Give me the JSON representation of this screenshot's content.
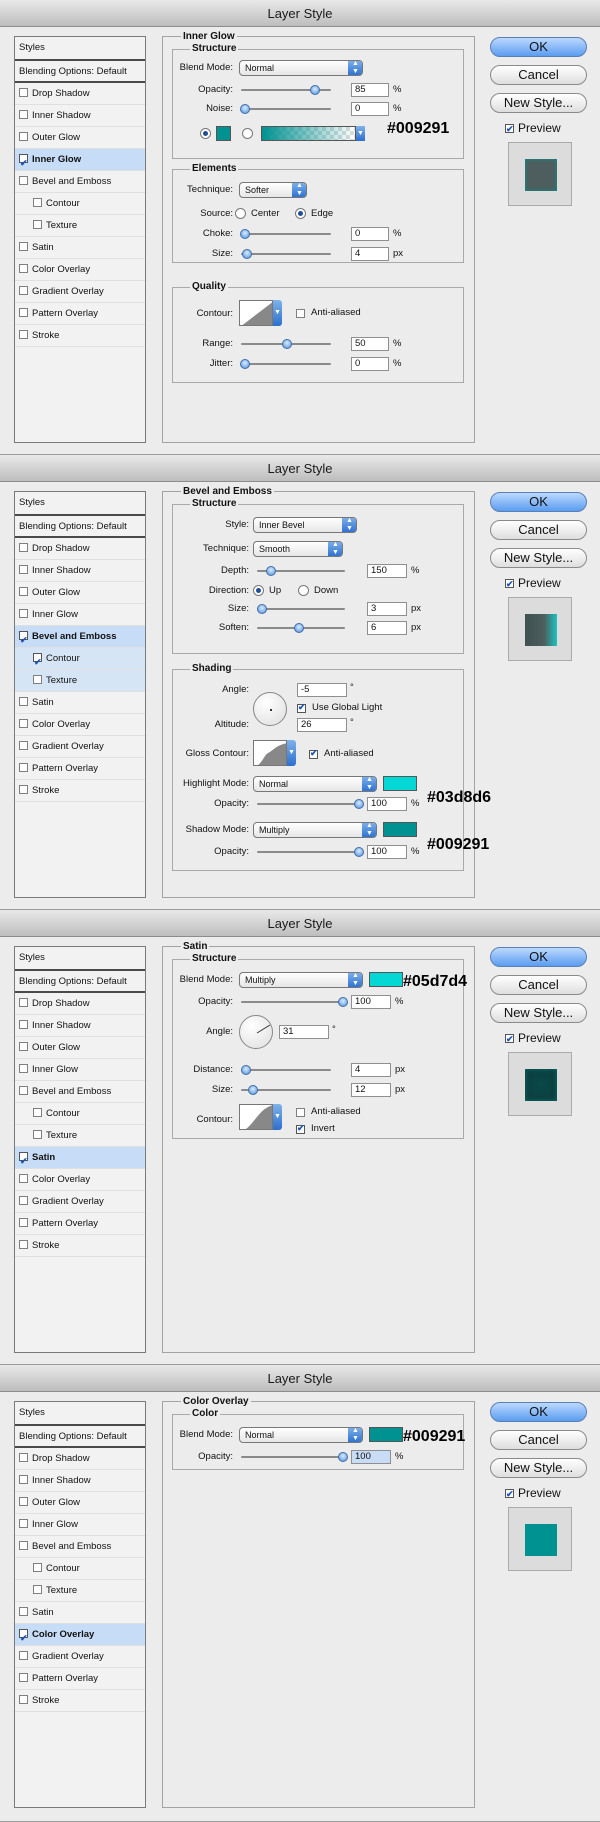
{
  "dialog_title": "Layer Style",
  "buttons": {
    "ok": "OK",
    "cancel": "Cancel",
    "new_style": "New Style...",
    "preview": "Preview"
  },
  "styles_list": [
    "Styles",
    "Blending Options: Default",
    "Drop Shadow",
    "Inner Shadow",
    "Outer Glow",
    "Inner Glow",
    "Bevel and Emboss",
    "Contour",
    "Texture",
    "Satin",
    "Color Overlay",
    "Gradient Overlay",
    "Pattern Overlay",
    "Stroke"
  ],
  "units": {
    "percent": "%",
    "px": "px",
    "deg": "°"
  },
  "panel1": {
    "section": "Inner Glow",
    "structure": "Structure",
    "blend_mode_label": "Blend Mode:",
    "blend_mode": "Normal",
    "opacity_label": "Opacity:",
    "opacity": "85",
    "noise_label": "Noise:",
    "noise": "0",
    "hex": "#009291",
    "elements": "Elements",
    "technique_label": "Technique:",
    "technique": "Softer",
    "source_label": "Source:",
    "source_center": "Center",
    "source_edge": "Edge",
    "choke_label": "Choke:",
    "choke": "0",
    "size_label": "Size:",
    "size": "4",
    "quality": "Quality",
    "contour_label": "Contour:",
    "anti_aliased": "Anti-aliased",
    "range_label": "Range:",
    "range": "50",
    "jitter_label": "Jitter:",
    "jitter": "0",
    "preview_color": "#4e5e5e"
  },
  "panel2": {
    "section": "Bevel and Emboss",
    "structure": "Structure",
    "style_label": "Style:",
    "style": "Inner Bevel",
    "technique_label": "Technique:",
    "technique": "Smooth",
    "depth_label": "Depth:",
    "depth": "150",
    "direction_label": "Direction:",
    "direction_up": "Up",
    "direction_down": "Down",
    "size_label": "Size:",
    "size": "3",
    "soften_label": "Soften:",
    "soften": "6",
    "shading": "Shading",
    "angle_label": "Angle:",
    "angle": "-5",
    "use_global_light": "Use Global Light",
    "altitude_label": "Altitude:",
    "altitude": "26",
    "gloss_contour_label": "Gloss Contour:",
    "anti_aliased": "Anti-aliased",
    "highlight_mode_label": "Highlight Mode:",
    "highlight_mode": "Normal",
    "highlight_hex": "#03d8d6",
    "highlight_opacity_label": "Opacity:",
    "highlight_opacity": "100",
    "shadow_mode_label": "Shadow Mode:",
    "shadow_mode": "Multiply",
    "shadow_hex": "#009291",
    "shadow_opacity_label": "Opacity:",
    "shadow_opacity": "100"
  },
  "panel3": {
    "section": "Satin",
    "structure": "Structure",
    "blend_mode_label": "Blend Mode:",
    "blend_mode": "Multiply",
    "hex": "#05d7d4",
    "opacity_label": "Opacity:",
    "opacity": "100",
    "angle_label": "Angle:",
    "angle": "31",
    "distance_label": "Distance:",
    "distance": "4",
    "size_label": "Size:",
    "size": "12",
    "contour_label": "Contour:",
    "anti_aliased": "Anti-aliased",
    "invert": "Invert"
  },
  "panel4": {
    "section": "Color Overlay",
    "color": "Color",
    "blend_mode_label": "Blend Mode:",
    "blend_mode": "Normal",
    "hex": "#009291",
    "opacity_label": "Opacity:",
    "opacity": "100"
  }
}
